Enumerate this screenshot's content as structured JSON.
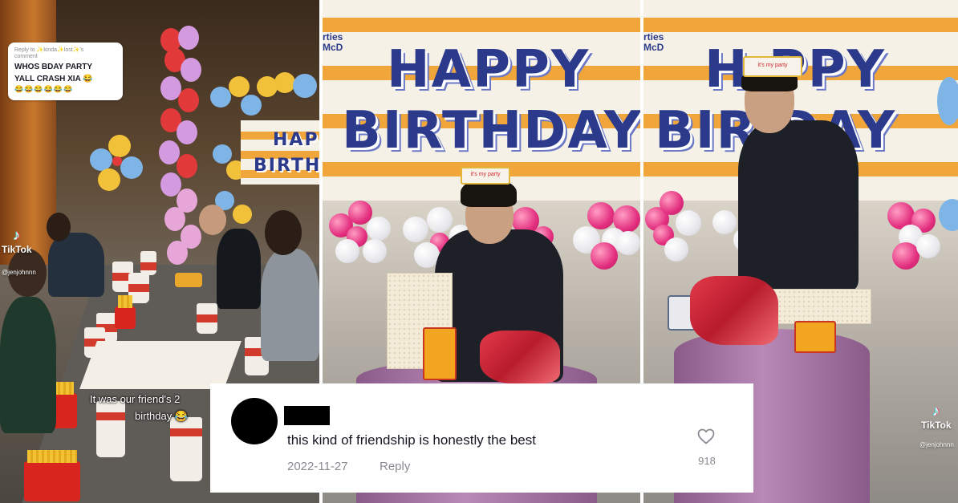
{
  "panel_left": {
    "reply_bubble": {
      "meta_line_1": "Reply to ✨kinda✨lost✨'s",
      "meta_line_2": "comment",
      "text_line_1": "WHOS BDAY PARTY",
      "text_line_2": "YALL CRASH XIA 😂",
      "emoji_row": "😂😂😂😂😂😂"
    },
    "tiktok_label": "TikTok",
    "tiktok_handle": "@jenjohnnn",
    "banner_partial": [
      "HAP",
      "BIRTH"
    ],
    "caption_line_1": "It was our friend's 2",
    "caption_line_2": "birthday 😂"
  },
  "panel_middle": {
    "banner_line_1": "HAPPY",
    "banner_line_2": "BIRTHDAY",
    "brand_tag_1": "rties",
    "brand_tag_2": "McD",
    "crown_text": "it's my party"
  },
  "panel_right": {
    "banner_line_1": "H  PPY",
    "banner_line_2": "BIR  DAY",
    "brand_tag_1": "rties",
    "brand_tag_2": "McD",
    "crown_text": "it's my party",
    "tiktok_label": "TikTok",
    "tiktok_handle": "@jenjohnnn"
  },
  "comment": {
    "text": "this kind of friendship is honestly the best",
    "date": "2022-11-27",
    "reply_label": "Reply",
    "like_count": "918",
    "icons": {
      "avatar": "avatar-redacted",
      "like": "heart-outline-icon"
    }
  },
  "colors": {
    "banner_text": "#2c3a8c",
    "banner_stripe": "#f0a63a",
    "comment_meta": "#8a8b91",
    "comment_text": "#161823"
  }
}
